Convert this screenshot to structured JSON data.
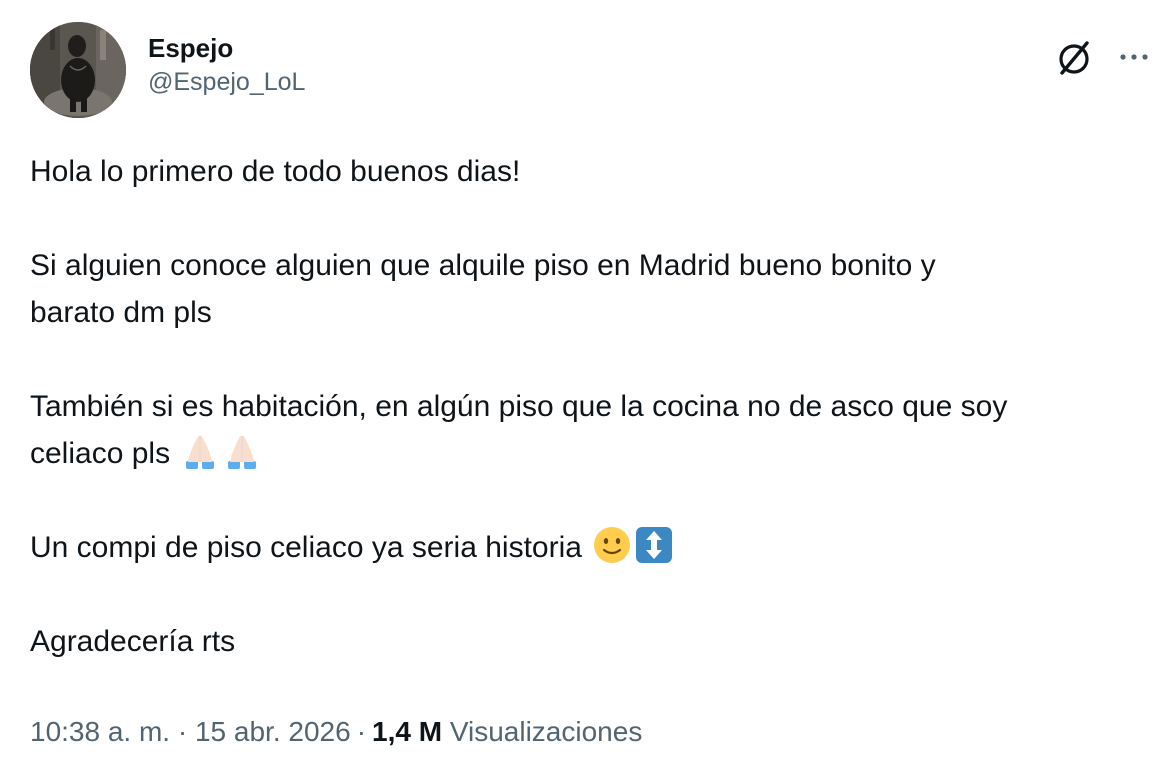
{
  "author": {
    "display_name": "Espejo",
    "handle": "@Espejo_LoL"
  },
  "header_icons": [
    "grok-icon",
    "more-options-icon"
  ],
  "more_label": "···",
  "tweet": {
    "p1": "Hola lo primero de todo buenos dias!",
    "p2_line1": "Si alguien conoce alguien que alquile piso en Madrid bueno bonito y",
    "p2_line2": "barato dm pls",
    "p3_line1": "También si es habitación, en algún piso que la cocina no de asco que soy",
    "p3_line2": "celiaco pls",
    "p3_emojis": [
      "folded-hands-light-skin",
      "folded-hands-light-skin"
    ],
    "p4": "Un compi de piso celiaco ya seria historia",
    "p4_emojis": [
      "slightly-smiling-face",
      "up-down-arrow"
    ],
    "p5": "Agradecería rts"
  },
  "meta": {
    "time": "10:38 a. m.",
    "separator": "·",
    "date": "15 abr. 2026",
    "views_count": "1,4 M",
    "views_label": "Visualizaciones"
  },
  "colors": {
    "text_primary": "#0f1419",
    "text_secondary": "#536471",
    "emoji_yellow": "#ffcc4d",
    "emoji_blue_box": "#3b88c3",
    "sleeve_blue": "#5dadec",
    "skin_light": "#f7dece"
  }
}
